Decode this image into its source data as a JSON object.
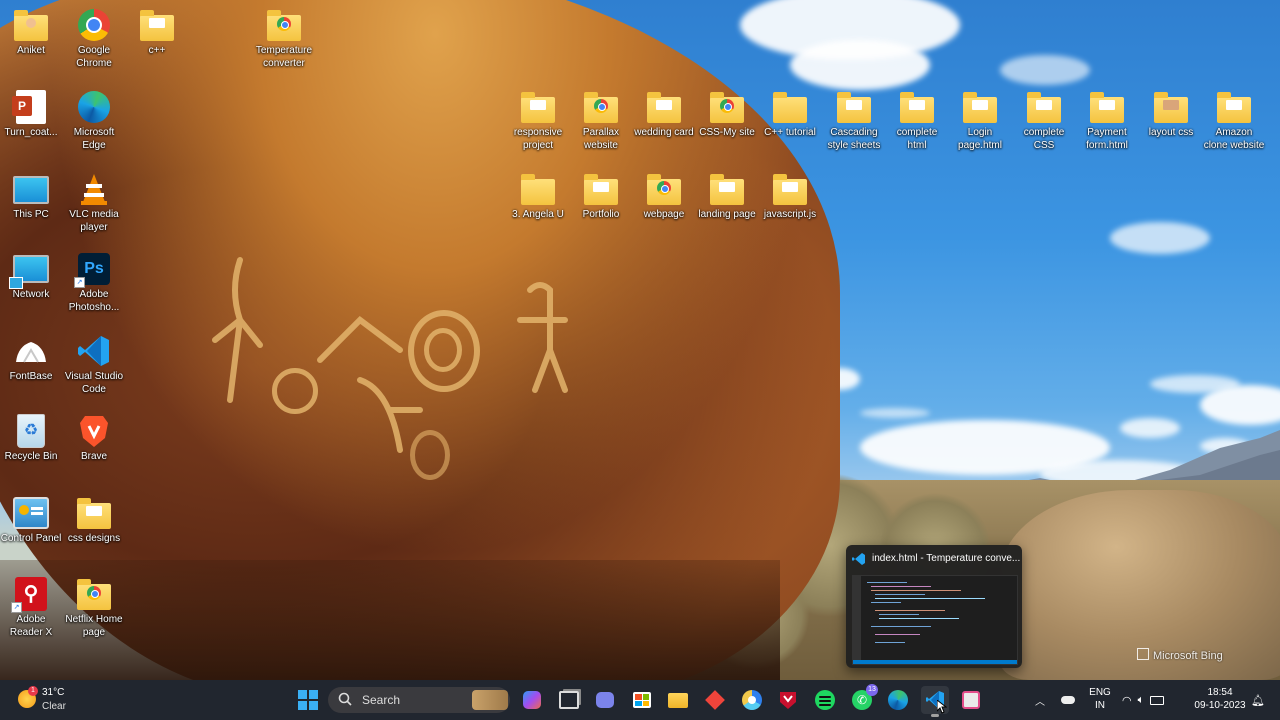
{
  "desktop": {
    "icons": [
      {
        "label": "Aniket"
      },
      {
        "label": "Google Chrome"
      },
      {
        "label": "c++"
      },
      {
        "label": "Temperature converter"
      },
      {
        "label": "Turn_coat..."
      },
      {
        "label": "Microsoft Edge"
      },
      {
        "label": "This PC"
      },
      {
        "label": "VLC media player"
      },
      {
        "label": "Network"
      },
      {
        "label": "Adobe Photosho..."
      },
      {
        "label": "FontBase"
      },
      {
        "label": "Visual Studio Code"
      },
      {
        "label": "Recycle Bin"
      },
      {
        "label": "Brave"
      },
      {
        "label": "Control Panel"
      },
      {
        "label": "css designs"
      },
      {
        "label": "Adobe Reader X"
      },
      {
        "label": "Netflix Home page"
      },
      {
        "label": "responsive project"
      },
      {
        "label": "Parallax website"
      },
      {
        "label": "wedding card"
      },
      {
        "label": "CSS-My site"
      },
      {
        "label": "C++ tutorial"
      },
      {
        "label": "Cascading style sheets"
      },
      {
        "label": "complete html"
      },
      {
        "label": "Login page.html"
      },
      {
        "label": "complete CSS"
      },
      {
        "label": "Payment form.html"
      },
      {
        "label": "layout css"
      },
      {
        "label": "Amazon clone website"
      },
      {
        "label": "3. Angela U"
      },
      {
        "label": "Portfolio"
      },
      {
        "label": "webpage"
      },
      {
        "label": "landing page"
      },
      {
        "label": "javascript.js"
      }
    ],
    "watermark": "Microsoft Bing"
  },
  "preview": {
    "title": "index.html - Temperature conve..."
  },
  "taskbar": {
    "weather": {
      "temp": "31°C",
      "condition": "Clear"
    },
    "search_label": "Search",
    "badge_whatsapp": "13",
    "tray": {
      "lang_line1": "ENG",
      "lang_line2": "IN",
      "time": "18:54",
      "date": "09-10-2023"
    }
  },
  "colors": {
    "taskbar_bg": "#202024",
    "accent": "#0078d4"
  }
}
